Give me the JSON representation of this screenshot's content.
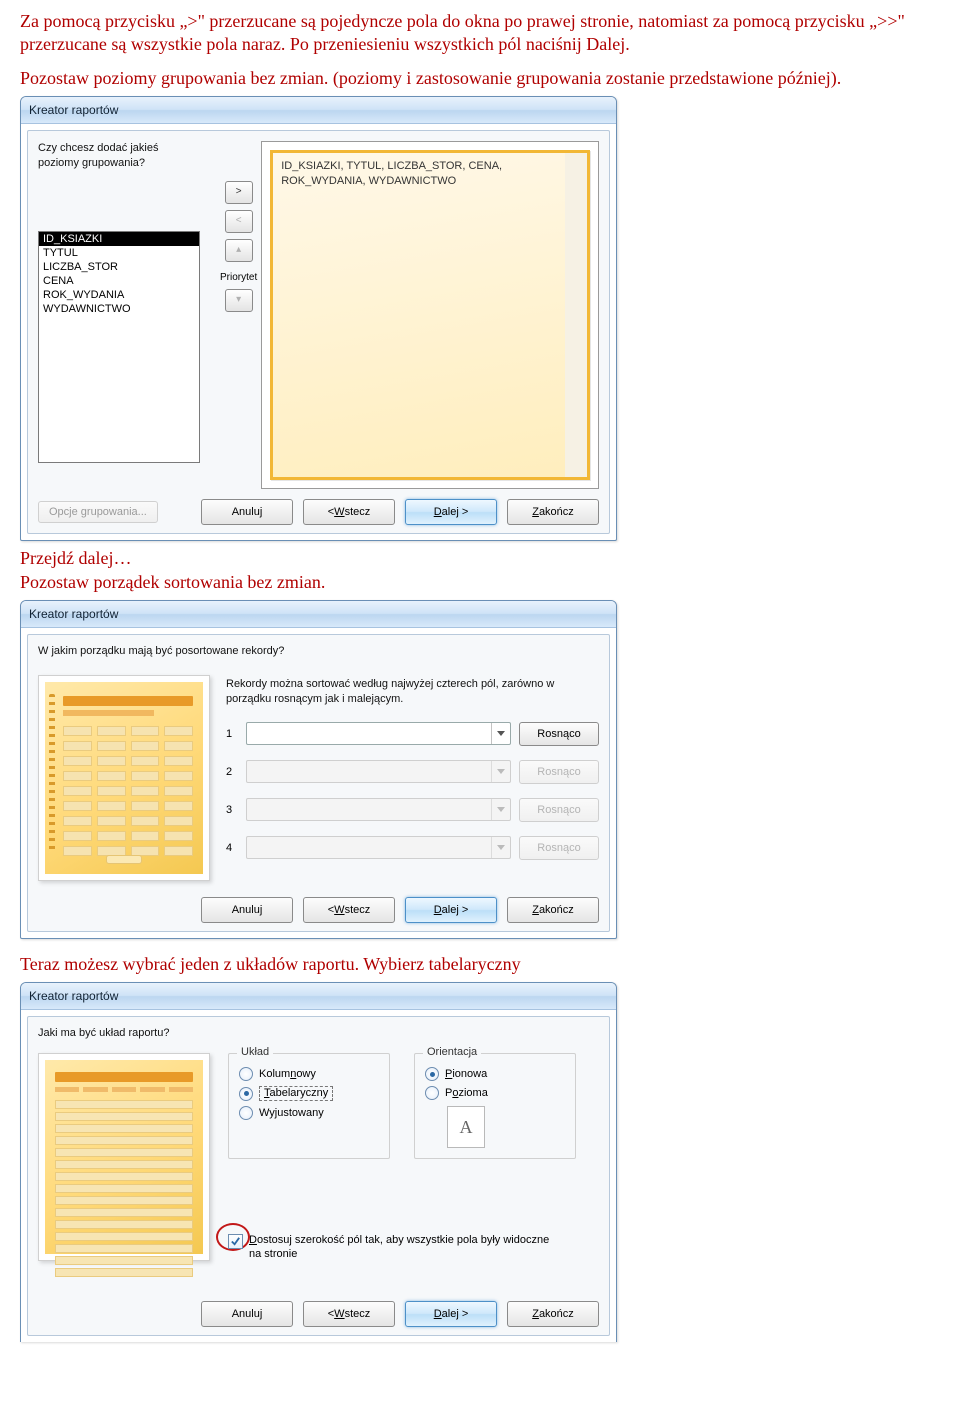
{
  "doc": {
    "p1": "Za pomocą przycisku „>\" przerzucane są pojedyncze pola do okna po prawej stronie, natomiast za pomocą przycisku „>>\" przerzucane są wszystkie pola naraz. Po przeniesieniu wszystkich pól naciśnij Dalej.",
    "p2": "Pozostaw poziomy grupowania bez zmian. (poziomy i zastosowanie grupowania zostanie przedstawione później).",
    "p3a": "Przejdź dalej…",
    "p3b": "Pozostaw porządek sortowania bez zmian.",
    "p4": "Teraz możesz wybrać jeden z układów raportu. Wybierz tabelaryczny"
  },
  "common": {
    "title": "Kreator raportów",
    "cancel": "Anuluj",
    "back_prefix": "< ",
    "back_u": "W",
    "back_rest": "stecz",
    "next_u": "D",
    "next_rest": "alej >",
    "finish_u": "Z",
    "finish_rest": "akończ"
  },
  "d1": {
    "question": "Czy chcesz dodać jakieś poziomy grupowania?",
    "list": [
      "ID_KSIAZKI",
      "TYTUL",
      "LICZBA_STOR",
      "CENA",
      "ROK_WYDANIA",
      "WYDAWNICTWO"
    ],
    "priority": "Priorytet",
    "preview_l1": "ID_KSIAZKI, TYTUL, LICZBA_STOR, CENA,",
    "preview_l2": "ROK_WYDANIA, WYDAWNICTWO",
    "group_opts": "Opcje grupowania..."
  },
  "d2": {
    "question": "W jakim porządku mają być posortowane rekordy?",
    "desc": "Rekordy można sortować według najwyżej czterech pól, zarówno w porządku rosnącym jak i malejącym.",
    "rows": [
      "1",
      "2",
      "3",
      "4"
    ],
    "order": "Rosnąco"
  },
  "d3": {
    "question": "Jaki ma być układ raportu?",
    "layout_label": "Układ",
    "orient_label": "Orientacja",
    "layout_kol_u": "n",
    "layout_kol_pre": "Kolum",
    "layout_kol_post": "owy",
    "layout_tab_u": "T",
    "layout_tab_post": "abelaryczny",
    "layout_wyj_u": "j",
    "layout_wyj_pre": "Wy",
    "layout_wyj_post": "ustowany",
    "orient_pion_u": "P",
    "orient_pion_post": "ionowa",
    "orient_poz_u": "o",
    "orient_poz_pre": "P",
    "orient_poz_post": "zioma",
    "orient_a": "A",
    "fit_u": "D",
    "fit_rest": "ostosuj szerokość pól tak, aby wszystkie pola były widoczne na stronie"
  }
}
